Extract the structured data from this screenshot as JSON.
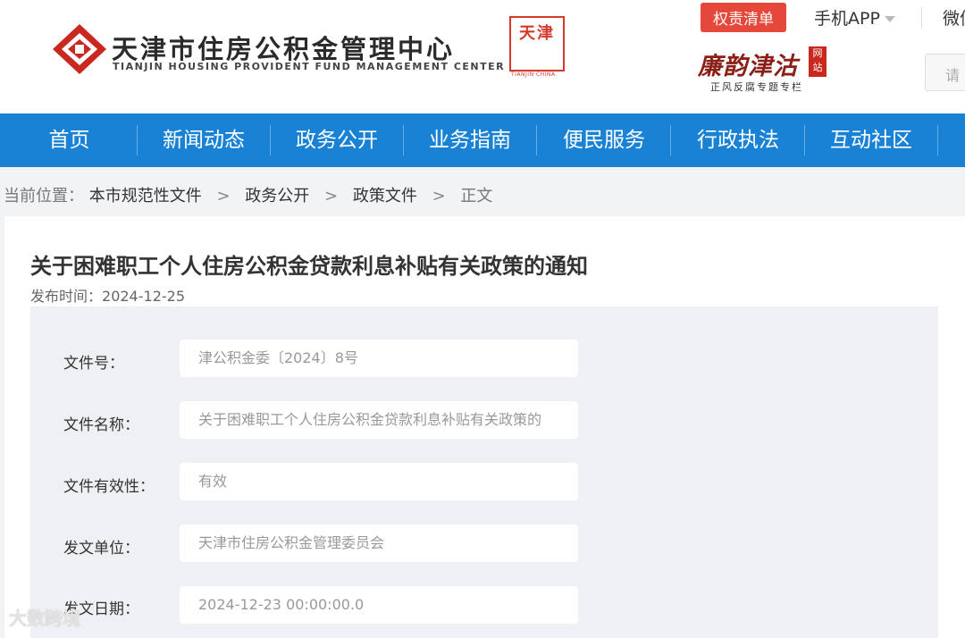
{
  "header": {
    "org_name": "天津市住房公积金管理中心",
    "org_name_en": "TIANJIN HOUSING PROVIDENT FUND MANAGEMENT CENTER",
    "seal_text": "天津",
    "seal_sub": "TIANJIN·CHINA",
    "duty_list_button": "权责清单",
    "mobile_app": "手机APP",
    "weixin": "微信",
    "lianyun_title": "廉韵津沽",
    "lianyun_tag": "网站",
    "lianyun_sub": "正风反腐专题专栏",
    "search_placeholder": "请"
  },
  "nav": {
    "items": [
      {
        "label": "首页"
      },
      {
        "label": "新闻动态"
      },
      {
        "label": "政务公开"
      },
      {
        "label": "业务指南"
      },
      {
        "label": "便民服务"
      },
      {
        "label": "行政执法"
      },
      {
        "label": "互动社区"
      }
    ]
  },
  "breadcrumb": {
    "prefix": "当前位置：",
    "items": [
      "本市规范性文件",
      "政务公开",
      "政策文件"
    ],
    "separator": ">",
    "current": "正文"
  },
  "article": {
    "title": "关于困难职工个人住房公积金贷款利息补贴有关政策的通知",
    "publish_label": "发布时间：",
    "publish_date": "2024-12-25"
  },
  "fields": [
    {
      "label": "文件号：",
      "value": "津公积金委〔2024〕8号"
    },
    {
      "label": "文件名称：",
      "value": "关于困难职工个人住房公积金贷款利息补贴有关政策的"
    },
    {
      "label": "文件有效性：",
      "value": "有效"
    },
    {
      "label": "发文单位：",
      "value": "天津市住房公积金管理委员会"
    },
    {
      "label": "发文日期：",
      "value": "2024-12-23 00:00:00.0"
    }
  ],
  "watermark": "大数跨境",
  "colors": {
    "nav_blue": "#1a82d4",
    "accent_red": "#e5483a",
    "panel_bg": "#eef0f4"
  }
}
